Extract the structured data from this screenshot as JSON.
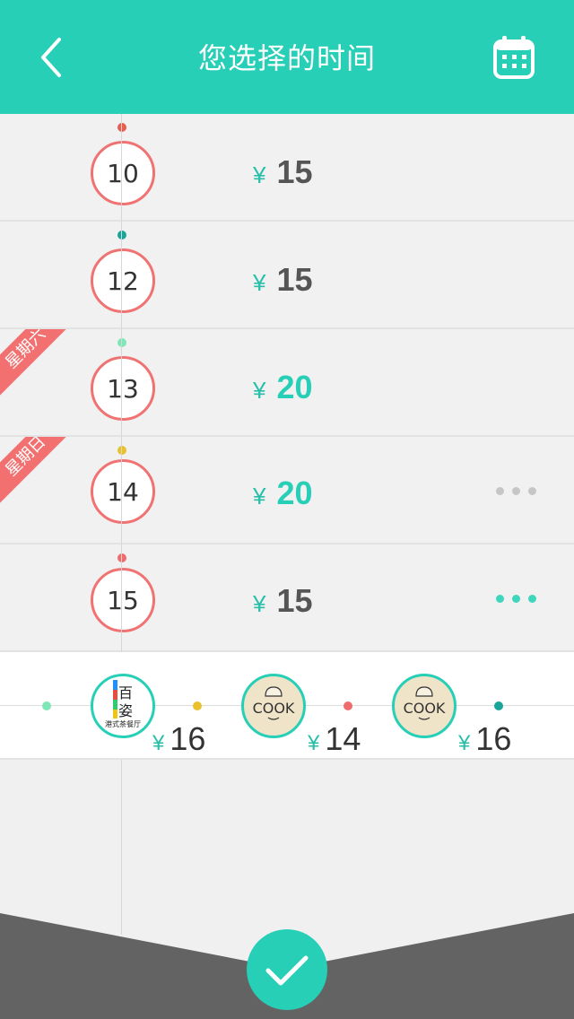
{
  "header": {
    "title": "您选择的时间",
    "back_icon": "chevron-left-icon",
    "calendar_icon": "calendar-icon"
  },
  "colors": {
    "accent": "#27cfb7",
    "circle_border": "#f07272",
    "ribbon": "#f27070"
  },
  "days": [
    {
      "day": "10",
      "price": "15",
      "dot_color": "#e85d4e",
      "highlight": false
    },
    {
      "day": "12",
      "price": "15",
      "dot_color": "#1aa59a",
      "highlight": false
    },
    {
      "day": "13",
      "price": "20",
      "dot_color": "#7de8b5",
      "highlight": true,
      "ribbon": "星期六"
    },
    {
      "day": "14",
      "price": "20",
      "dot_color": "#e9c12a",
      "highlight": true,
      "ribbon": "星期日",
      "more_color": "#c6c6c6"
    },
    {
      "day": "15",
      "price": "15",
      "dot_color": "#f06c6c",
      "highlight": false,
      "more_color": "#3fd6bd"
    }
  ],
  "currency": "¥",
  "shops": [
    {
      "name": "港式茶餐厅",
      "logo_type": "tea",
      "price": "16"
    },
    {
      "name": "COOK",
      "logo_type": "cook",
      "price": "14"
    },
    {
      "name": "COOK",
      "logo_type": "cook",
      "price": "16"
    }
  ],
  "shop_dots": [
    "#7de8b5",
    "#e9c12a",
    "#f06c6c",
    "#1aa59a"
  ],
  "confirm_icon": "checkmark-icon"
}
